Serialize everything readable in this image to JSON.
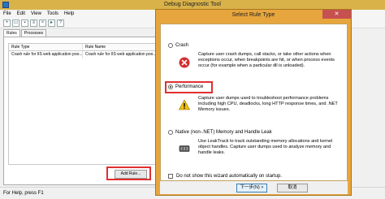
{
  "main": {
    "title": "Debug Diagnostic Tool",
    "menu": [
      "File",
      "Edit",
      "View",
      "Tools",
      "Help"
    ],
    "tabs": [
      "Rules",
      "Processes"
    ],
    "grid": {
      "columns": [
        "Rule Type",
        "Rule Name"
      ],
      "rows": [
        [
          "Crash rule for IIS web application poo...",
          "Crash rule for IIS web application poo..."
        ]
      ]
    },
    "add_rule_label": "Add Rule...",
    "status": "For Help, press F1"
  },
  "dialog": {
    "title": "Select Rule Type",
    "close_glyph": "✕",
    "options": [
      {
        "label": "Crash",
        "checked": false,
        "icon": "error-icon",
        "desc": "Capture user crash dumps, call stacks, or take other actions when exceptions occur, when breakpoints are hit, or when process events occur (for example when a particular dll is unloaded)."
      },
      {
        "label": "Performance",
        "checked": true,
        "icon": "warning-icon",
        "desc": "Capture user dumps used to troubleshoot performance problems including high CPU, deadlocks, long HTTP response times, and .NET Memory issues."
      },
      {
        "label": "Native (non-.NET) Memory and Handle Leak",
        "checked": false,
        "icon": "memory-chip-icon",
        "desc": "Use LeakTrack to track outstanding memory allocations and kernel object handles. Capture user dumps used to analyze memory and handle leaks."
      }
    ],
    "dont_show": "Do not show this wizard automatically on startup.",
    "buttons": {
      "next": "下一步(N) >",
      "cancel": "取消"
    }
  },
  "colors": {
    "title_bar": "#e7a63d",
    "highlight": "#e03030"
  }
}
